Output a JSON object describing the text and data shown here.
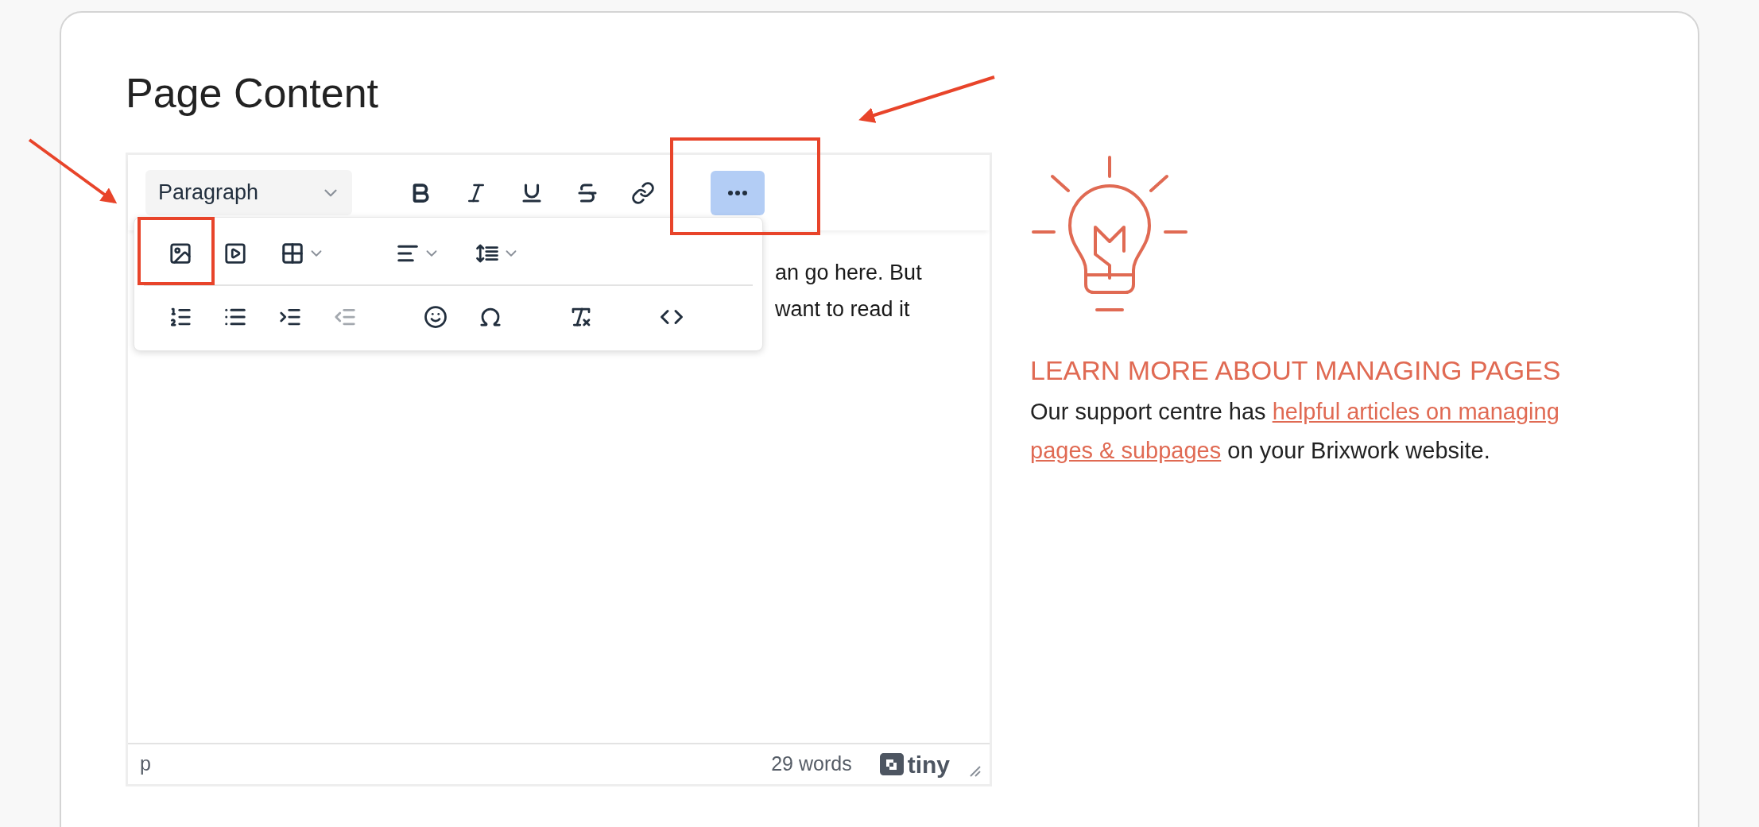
{
  "page_title": "Page Content",
  "editor": {
    "block_format": "Paragraph",
    "toolbar": [
      {
        "kind": "bold",
        "selected": false
      },
      {
        "kind": "italic",
        "selected": false
      },
      {
        "kind": "underline",
        "selected": false
      },
      {
        "kind": "strikethrough",
        "selected": false
      },
      {
        "kind": "link",
        "selected": false
      },
      {
        "kind": "more",
        "selected": true
      }
    ],
    "popup_rows": [
      [
        [
          {
            "kind": "image",
            "disabled": false
          },
          {
            "kind": "media",
            "disabled": false
          },
          {
            "kind": "table",
            "disabled": false
          }
        ],
        [
          {
            "kind": "align",
            "disabled": false
          },
          {
            "kind": "line-height",
            "disabled": false
          }
        ]
      ],
      [
        [
          {
            "kind": "numbered-list",
            "disabled": false
          },
          {
            "kind": "bullet-list",
            "disabled": false
          },
          {
            "kind": "indent",
            "disabled": false
          },
          {
            "kind": "outdent",
            "disabled": true
          }
        ],
        [
          {
            "kind": "emoji",
            "disabled": false
          },
          {
            "kind": "special-character",
            "disabled": false
          }
        ],
        [
          {
            "kind": "clear-formatting",
            "disabled": false
          }
        ],
        [
          {
            "kind": "source-code",
            "disabled": false
          }
        ]
      ]
    ],
    "content_lines": [
      "an go here. But",
      "want to read it"
    ],
    "status": {
      "path": "p",
      "word_count": "29 words",
      "brand": "tiny"
    }
  },
  "help": {
    "heading": "LEARN MORE ABOUT MANAGING PAGES",
    "parts": [
      {
        "kind": "plain",
        "text": "Our support centre has"
      },
      {
        "kind": "link",
        "text": "helpful articles on managing"
      },
      {
        "kind": "link",
        "text": "pages & subpages"
      },
      {
        "kind": "plain",
        "text": "on your Brixwork website."
      }
    ]
  }
}
